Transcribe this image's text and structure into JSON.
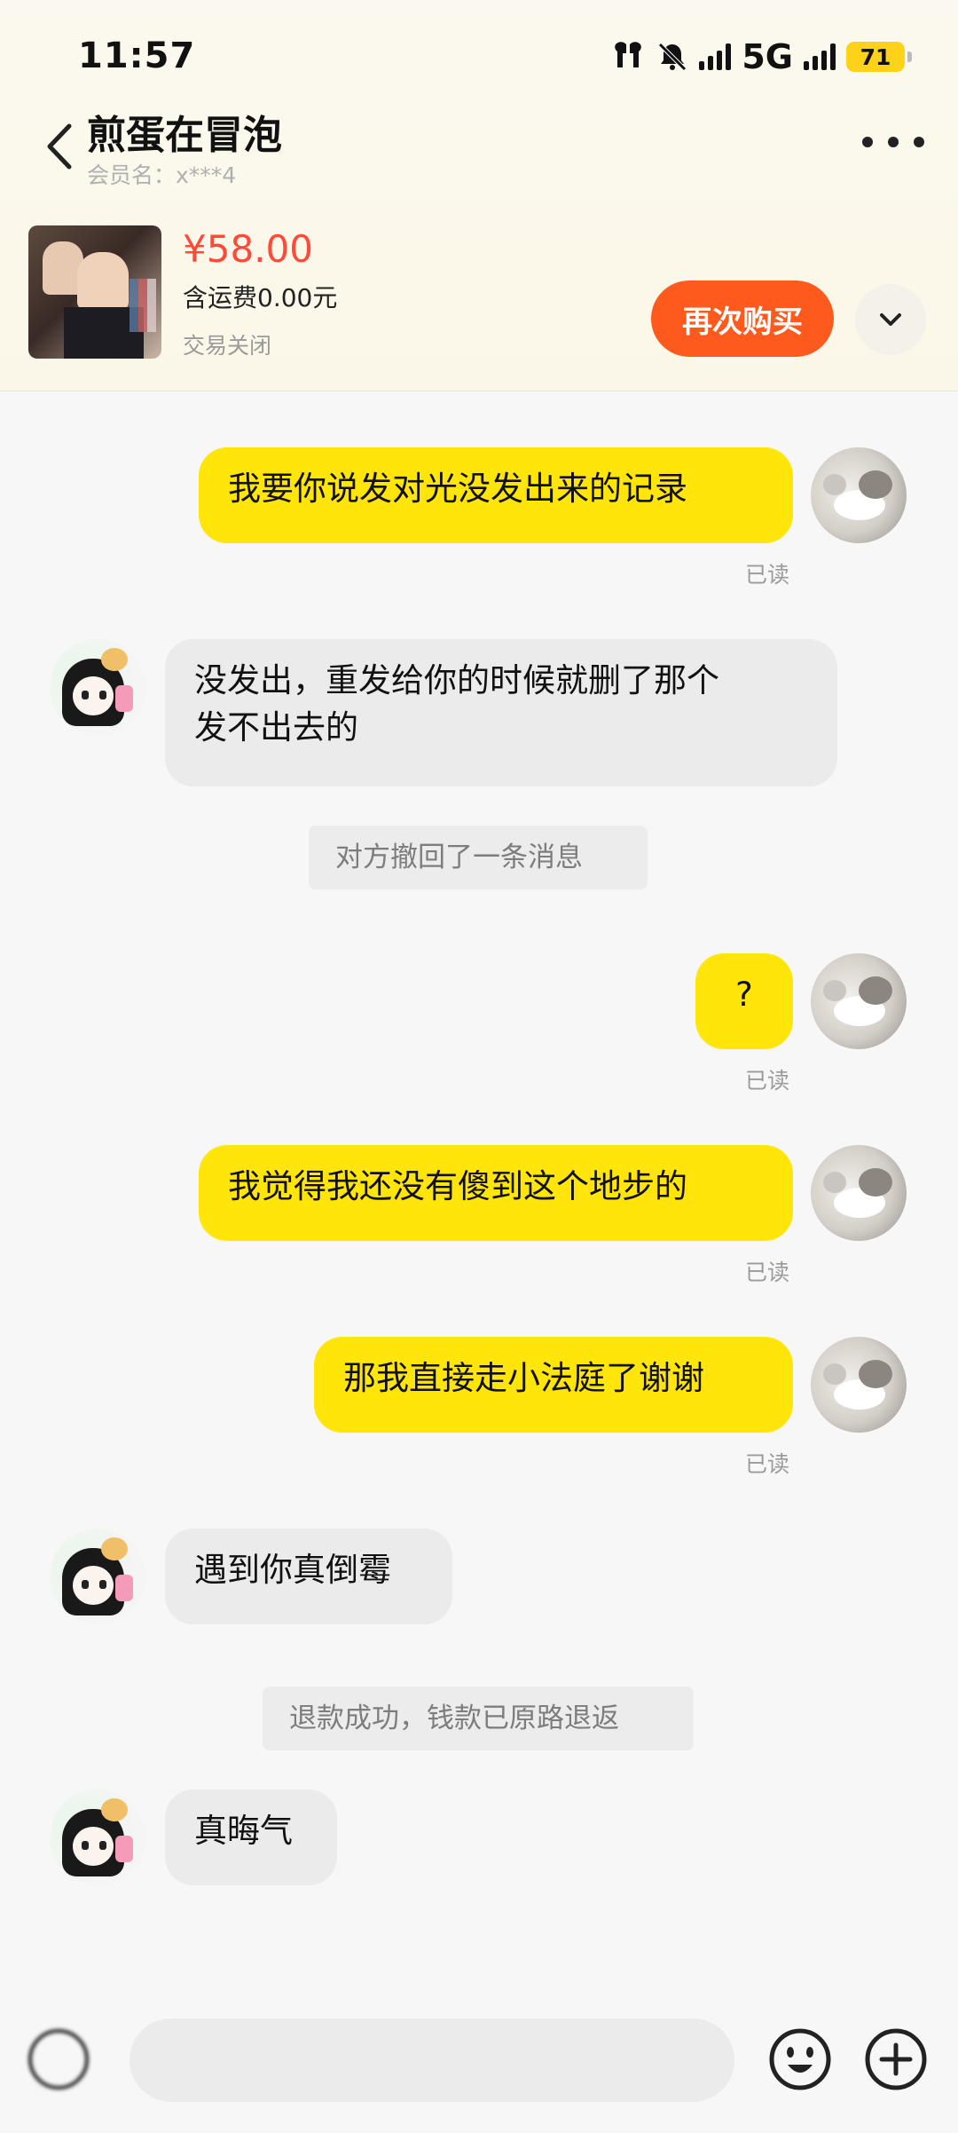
{
  "status_bar": {
    "time": "11:57",
    "network": "5G",
    "battery": "71"
  },
  "header": {
    "title": "煎蛋在冒泡",
    "subtitle": "会员名：x***4"
  },
  "order": {
    "price": "¥58.00",
    "shipping": "含运费0.00元",
    "status": "交易关闭",
    "rebuy_label": "再次购买"
  },
  "messages": [
    {
      "from": "me",
      "text": "我要你说发对光没发出来的记录",
      "read": "已读"
    },
    {
      "from": "them",
      "line1": "没发出，重发给你的时候就删了那个",
      "line2": "发不出去的"
    },
    {
      "from": "system",
      "text": "对方撤回了一条消息"
    },
    {
      "from": "me",
      "text": "?",
      "read": "已读"
    },
    {
      "from": "me",
      "text": "我觉得我还没有傻到这个地步的",
      "read": "已读"
    },
    {
      "from": "me",
      "text": "那我直接走小法庭了谢谢",
      "read": "已读"
    },
    {
      "from": "them",
      "text": "遇到你真倒霉"
    },
    {
      "from": "system",
      "text": "退款成功，钱款已原路退返"
    },
    {
      "from": "them",
      "text": "真晦气"
    }
  ],
  "icons": {
    "back": "chevron-left-icon",
    "more": "more-icon",
    "expand": "chevron-down-icon",
    "voice": "voice-icon",
    "emoji": "emoji-icon",
    "plus": "plus-icon"
  },
  "colors": {
    "my_bubble": "#ffe50a",
    "their_bubble": "#ebebeb",
    "price": "#ff4a3a",
    "rebuy_button": "#ff5a1d"
  }
}
